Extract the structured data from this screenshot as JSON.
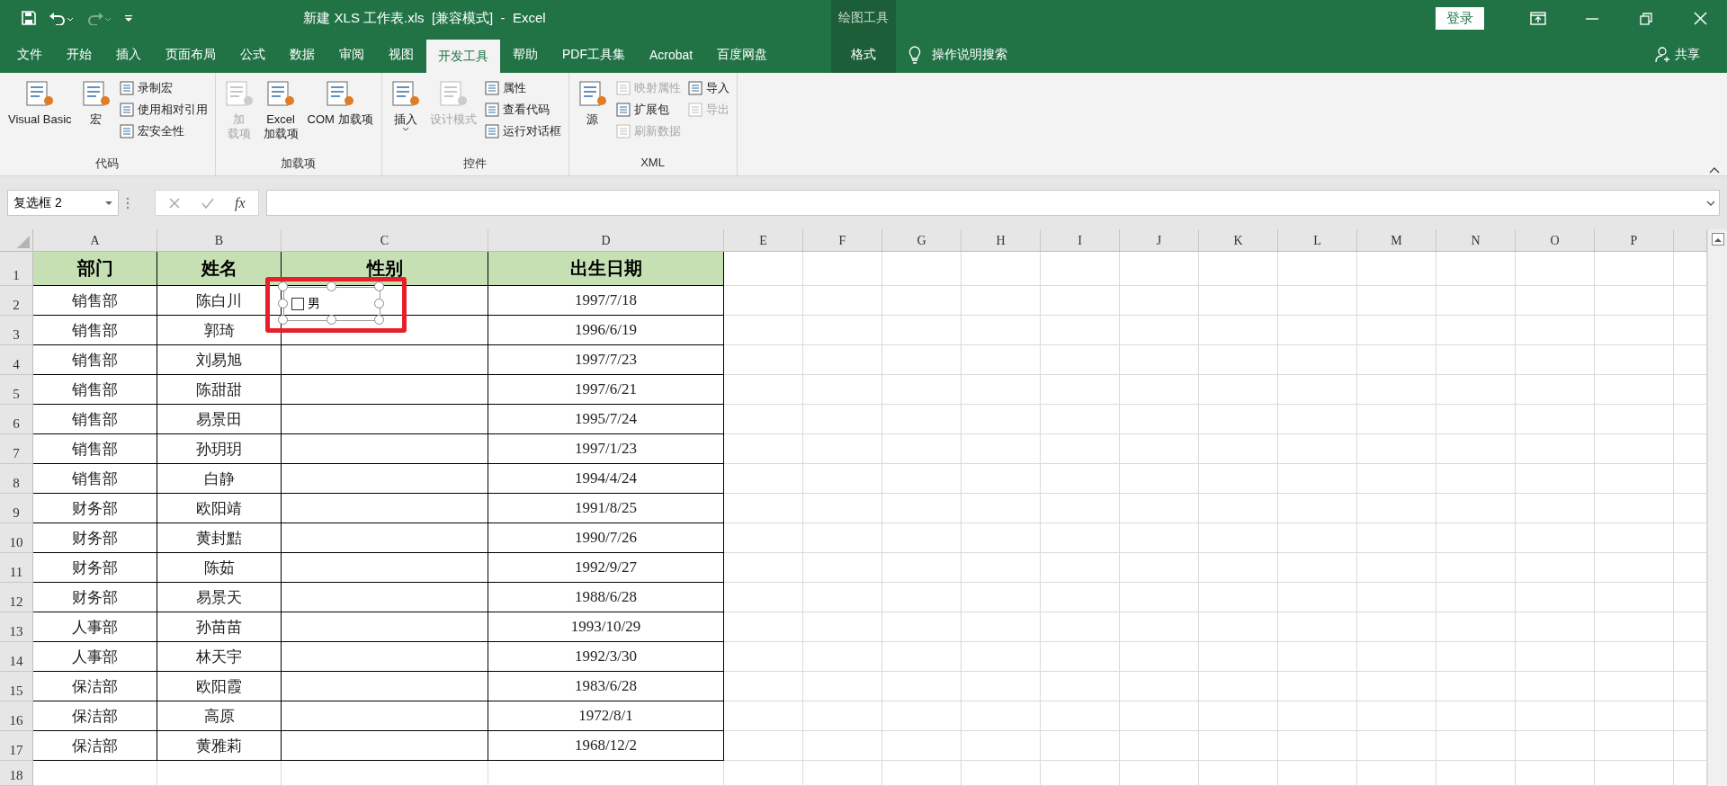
{
  "title_bar": {
    "title": "新建 XLS 工作表.xls  [兼容模式]  -  Excel",
    "context_label": "绘图工具",
    "sign_in": "登录"
  },
  "tabs": [
    {
      "label": "文件",
      "selected": false,
      "kind": "normal"
    },
    {
      "label": "开始",
      "selected": false,
      "kind": "normal"
    },
    {
      "label": "插入",
      "selected": false,
      "kind": "normal"
    },
    {
      "label": "页面布局",
      "selected": false,
      "kind": "normal"
    },
    {
      "label": "公式",
      "selected": false,
      "kind": "normal"
    },
    {
      "label": "数据",
      "selected": false,
      "kind": "normal"
    },
    {
      "label": "审阅",
      "selected": false,
      "kind": "normal"
    },
    {
      "label": "视图",
      "selected": false,
      "kind": "normal"
    },
    {
      "label": "开发工具",
      "selected": true,
      "kind": "normal"
    },
    {
      "label": "帮助",
      "selected": false,
      "kind": "normal"
    },
    {
      "label": "PDF工具集",
      "selected": false,
      "kind": "normal"
    },
    {
      "label": "Acrobat",
      "selected": false,
      "kind": "normal"
    },
    {
      "label": "百度网盘",
      "selected": false,
      "kind": "normal"
    },
    {
      "label": "格式",
      "selected": false,
      "kind": "contextual"
    }
  ],
  "tell_me": "操作说明搜索",
  "share": "共享",
  "ribbon": {
    "groups": [
      {
        "label": "代码",
        "items": [
          {
            "kind": "large",
            "lines": [
              "Visual Basic"
            ],
            "disabled": false
          },
          {
            "kind": "large",
            "lines": [
              "宏"
            ],
            "disabled": false
          },
          {
            "kind": "small",
            "label": "录制宏",
            "disabled": false
          },
          {
            "kind": "small",
            "label": "使用相对引用",
            "disabled": false
          },
          {
            "kind": "small",
            "label": "宏安全性",
            "disabled": false
          }
        ]
      },
      {
        "label": "加载项",
        "items": [
          {
            "kind": "large",
            "lines": [
              "加",
              "载项"
            ],
            "disabled": true
          },
          {
            "kind": "large",
            "lines": [
              "Excel",
              "加载项"
            ],
            "disabled": false
          },
          {
            "kind": "large",
            "lines": [
              "COM 加载项"
            ],
            "disabled": false
          }
        ]
      },
      {
        "label": "控件",
        "items": [
          {
            "kind": "large",
            "lines": [
              "插入"
            ],
            "disabled": false,
            "dropdown": true
          },
          {
            "kind": "large",
            "lines": [
              "设计模式"
            ],
            "disabled": true
          },
          {
            "kind": "small",
            "label": "属性",
            "disabled": false
          },
          {
            "kind": "small",
            "label": "查看代码",
            "disabled": false
          },
          {
            "kind": "small",
            "label": "运行对话框",
            "disabled": false
          }
        ]
      },
      {
        "label": "XML",
        "items": [
          {
            "kind": "large",
            "lines": [
              "源"
            ],
            "disabled": false
          },
          {
            "kind": "small",
            "label": "映射属性",
            "disabled": true
          },
          {
            "kind": "small",
            "label": "扩展包",
            "disabled": false
          },
          {
            "kind": "small",
            "label": "刷新数据",
            "disabled": true
          },
          {
            "kind": "small",
            "label": "导入",
            "disabled": false
          },
          {
            "kind": "small",
            "label": "导出",
            "disabled": true
          }
        ]
      }
    ]
  },
  "formula_bar": {
    "name_box": "复选框 2",
    "function_label": "fx"
  },
  "sheet": {
    "columns": [
      "A",
      "B",
      "C",
      "D",
      "E",
      "F",
      "G",
      "H",
      "I",
      "J",
      "K",
      "L",
      "M",
      "N",
      "O",
      "P"
    ],
    "rows": [
      {
        "number": "1",
        "kind": "header",
        "cells": {
          "A": "部门",
          "B": "姓名",
          "C": "性别",
          "D": "出生日期"
        }
      },
      {
        "number": "2",
        "kind": "data",
        "cells": {
          "A": "销售部",
          "B": "陈白川",
          "D": "1997/7/18"
        }
      },
      {
        "number": "3",
        "kind": "data",
        "cells": {
          "A": "销售部",
          "B": "郭琦",
          "D": "1996/6/19"
        }
      },
      {
        "number": "4",
        "kind": "data",
        "cells": {
          "A": "销售部",
          "B": "刘易旭",
          "D": "1997/7/23"
        }
      },
      {
        "number": "5",
        "kind": "data",
        "cells": {
          "A": "销售部",
          "B": "陈甜甜",
          "D": "1997/6/21"
        }
      },
      {
        "number": "6",
        "kind": "data",
        "cells": {
          "A": "销售部",
          "B": "易景田",
          "D": "1995/7/24"
        }
      },
      {
        "number": "7",
        "kind": "data",
        "cells": {
          "A": "销售部",
          "B": "孙玥玥",
          "D": "1997/1/23"
        }
      },
      {
        "number": "8",
        "kind": "data",
        "cells": {
          "A": "销售部",
          "B": "白静",
          "D": "1994/4/24"
        }
      },
      {
        "number": "9",
        "kind": "data",
        "cells": {
          "A": "财务部",
          "B": "欧阳靖",
          "D": "1991/8/25"
        }
      },
      {
        "number": "10",
        "kind": "data",
        "cells": {
          "A": "财务部",
          "B": "黄封黠",
          "D": "1990/7/26"
        }
      },
      {
        "number": "11",
        "kind": "data",
        "cells": {
          "A": "财务部",
          "B": "陈茹",
          "D": "1992/9/27"
        }
      },
      {
        "number": "12",
        "kind": "data",
        "cells": {
          "A": "财务部",
          "B": "易景天",
          "D": "1988/6/28"
        }
      },
      {
        "number": "13",
        "kind": "data",
        "cells": {
          "A": "人事部",
          "B": "孙苗苗",
          "D": "1993/10/29"
        }
      },
      {
        "number": "14",
        "kind": "data",
        "cells": {
          "A": "人事部",
          "B": "林天宇",
          "D": "1992/3/30"
        }
      },
      {
        "number": "15",
        "kind": "data",
        "cells": {
          "A": "保洁部",
          "B": "欧阳霞",
          "D": "1983/6/28"
        }
      },
      {
        "number": "16",
        "kind": "data",
        "cells": {
          "A": "保洁部",
          "B": "高原",
          "D": "1972/8/1"
        }
      },
      {
        "number": "17",
        "kind": "data",
        "cells": {
          "A": "保洁部",
          "B": "黄雅莉",
          "D": "1968/12/2"
        }
      },
      {
        "number": "18",
        "kind": "data"
      }
    ],
    "checkbox": {
      "label": "男",
      "checked": false,
      "selected": true
    }
  }
}
